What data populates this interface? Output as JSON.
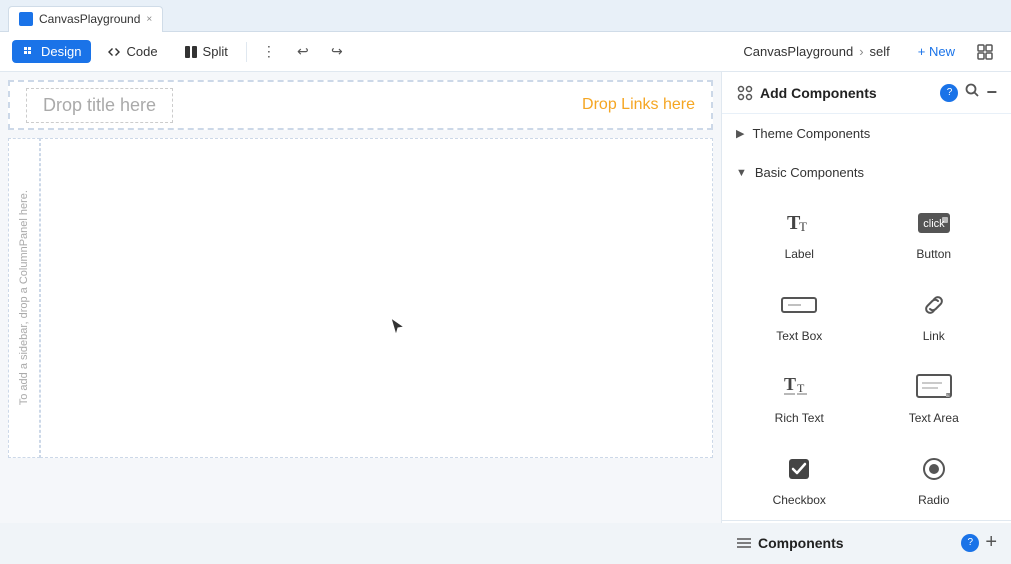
{
  "tab": {
    "favicon": "canvas",
    "title": "CanvasPlayground",
    "close": "×"
  },
  "toolbar": {
    "design_label": "Design",
    "code_label": "Code",
    "split_label": "Split",
    "more_icon": "⋮",
    "undo_icon": "↩",
    "redo_icon": "↪",
    "breadcrumb_app": "CanvasPlayground",
    "breadcrumb_sep": "›",
    "breadcrumb_page": "self",
    "new_label": "+ New",
    "layout_icon": "⊞"
  },
  "canvas": {
    "drop_title": "Drop title here",
    "drop_links": "Drop Links here",
    "sidebar_hint": "To add a sidebar, drop a ColumnPanel here."
  },
  "right_panel": {
    "add_components_title": "Add Components",
    "help_label": "?",
    "components_title": "Components",
    "components_help": "?",
    "theme_section": "Theme Components",
    "basic_section": "Basic Components",
    "items": [
      {
        "name": "Label",
        "icon": "label"
      },
      {
        "name": "Button",
        "icon": "button"
      },
      {
        "name": "Text Box",
        "icon": "textbox"
      },
      {
        "name": "Link",
        "icon": "link"
      },
      {
        "name": "Rich Text",
        "icon": "richtext"
      },
      {
        "name": "Text Area",
        "icon": "textarea"
      },
      {
        "name": "Checkbox",
        "icon": "checkbox"
      },
      {
        "name": "Radio",
        "icon": "radio"
      }
    ],
    "add_icon": "+"
  }
}
